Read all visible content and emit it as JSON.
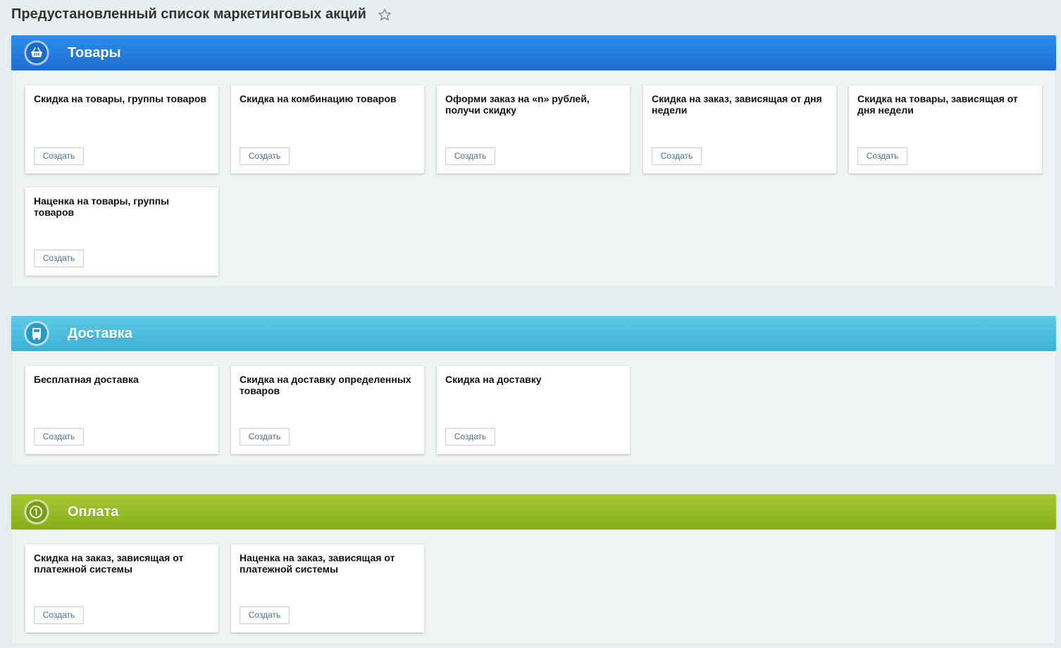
{
  "page": {
    "title": "Предустановленный список маркетинговых акций",
    "favorite_icon": "star-outline-icon"
  },
  "sections": [
    {
      "title": "Товары",
      "icon": "basket-icon",
      "color": "#1f74d9",
      "cards": [
        {
          "title": "Скидка на товары, группы товаров",
          "button": "Создать"
        },
        {
          "title": "Скидка на комбинацию товаров",
          "button": "Создать"
        },
        {
          "title": "Оформи заказ на «n» рублей, получи скидку",
          "button": "Создать"
        },
        {
          "title": "Скидка на заказ, зависящая от дня недели",
          "button": "Создать"
        },
        {
          "title": "Скидка на товары, зависящая от дня недели",
          "button": "Создать"
        },
        {
          "title": "Наценка на товары, группы товаров",
          "button": "Создать"
        }
      ]
    },
    {
      "title": "Доставка",
      "icon": "truck-icon",
      "color": "#49bbdc",
      "cards": [
        {
          "title": "Бесплатная доставка",
          "button": "Создать"
        },
        {
          "title": "Скидка на доставку определенных товаров",
          "button": "Создать"
        },
        {
          "title": "Скидка на доставку",
          "button": "Создать"
        }
      ]
    },
    {
      "title": "Оплата",
      "icon": "coin-icon",
      "color": "#94b824",
      "cards": [
        {
          "title": "Скидка на заказ, зависящая от платежной системы",
          "button": "Создать"
        },
        {
          "title": "Наценка на заказ, зависящая от платежной системы",
          "button": "Создать"
        }
      ]
    }
  ]
}
